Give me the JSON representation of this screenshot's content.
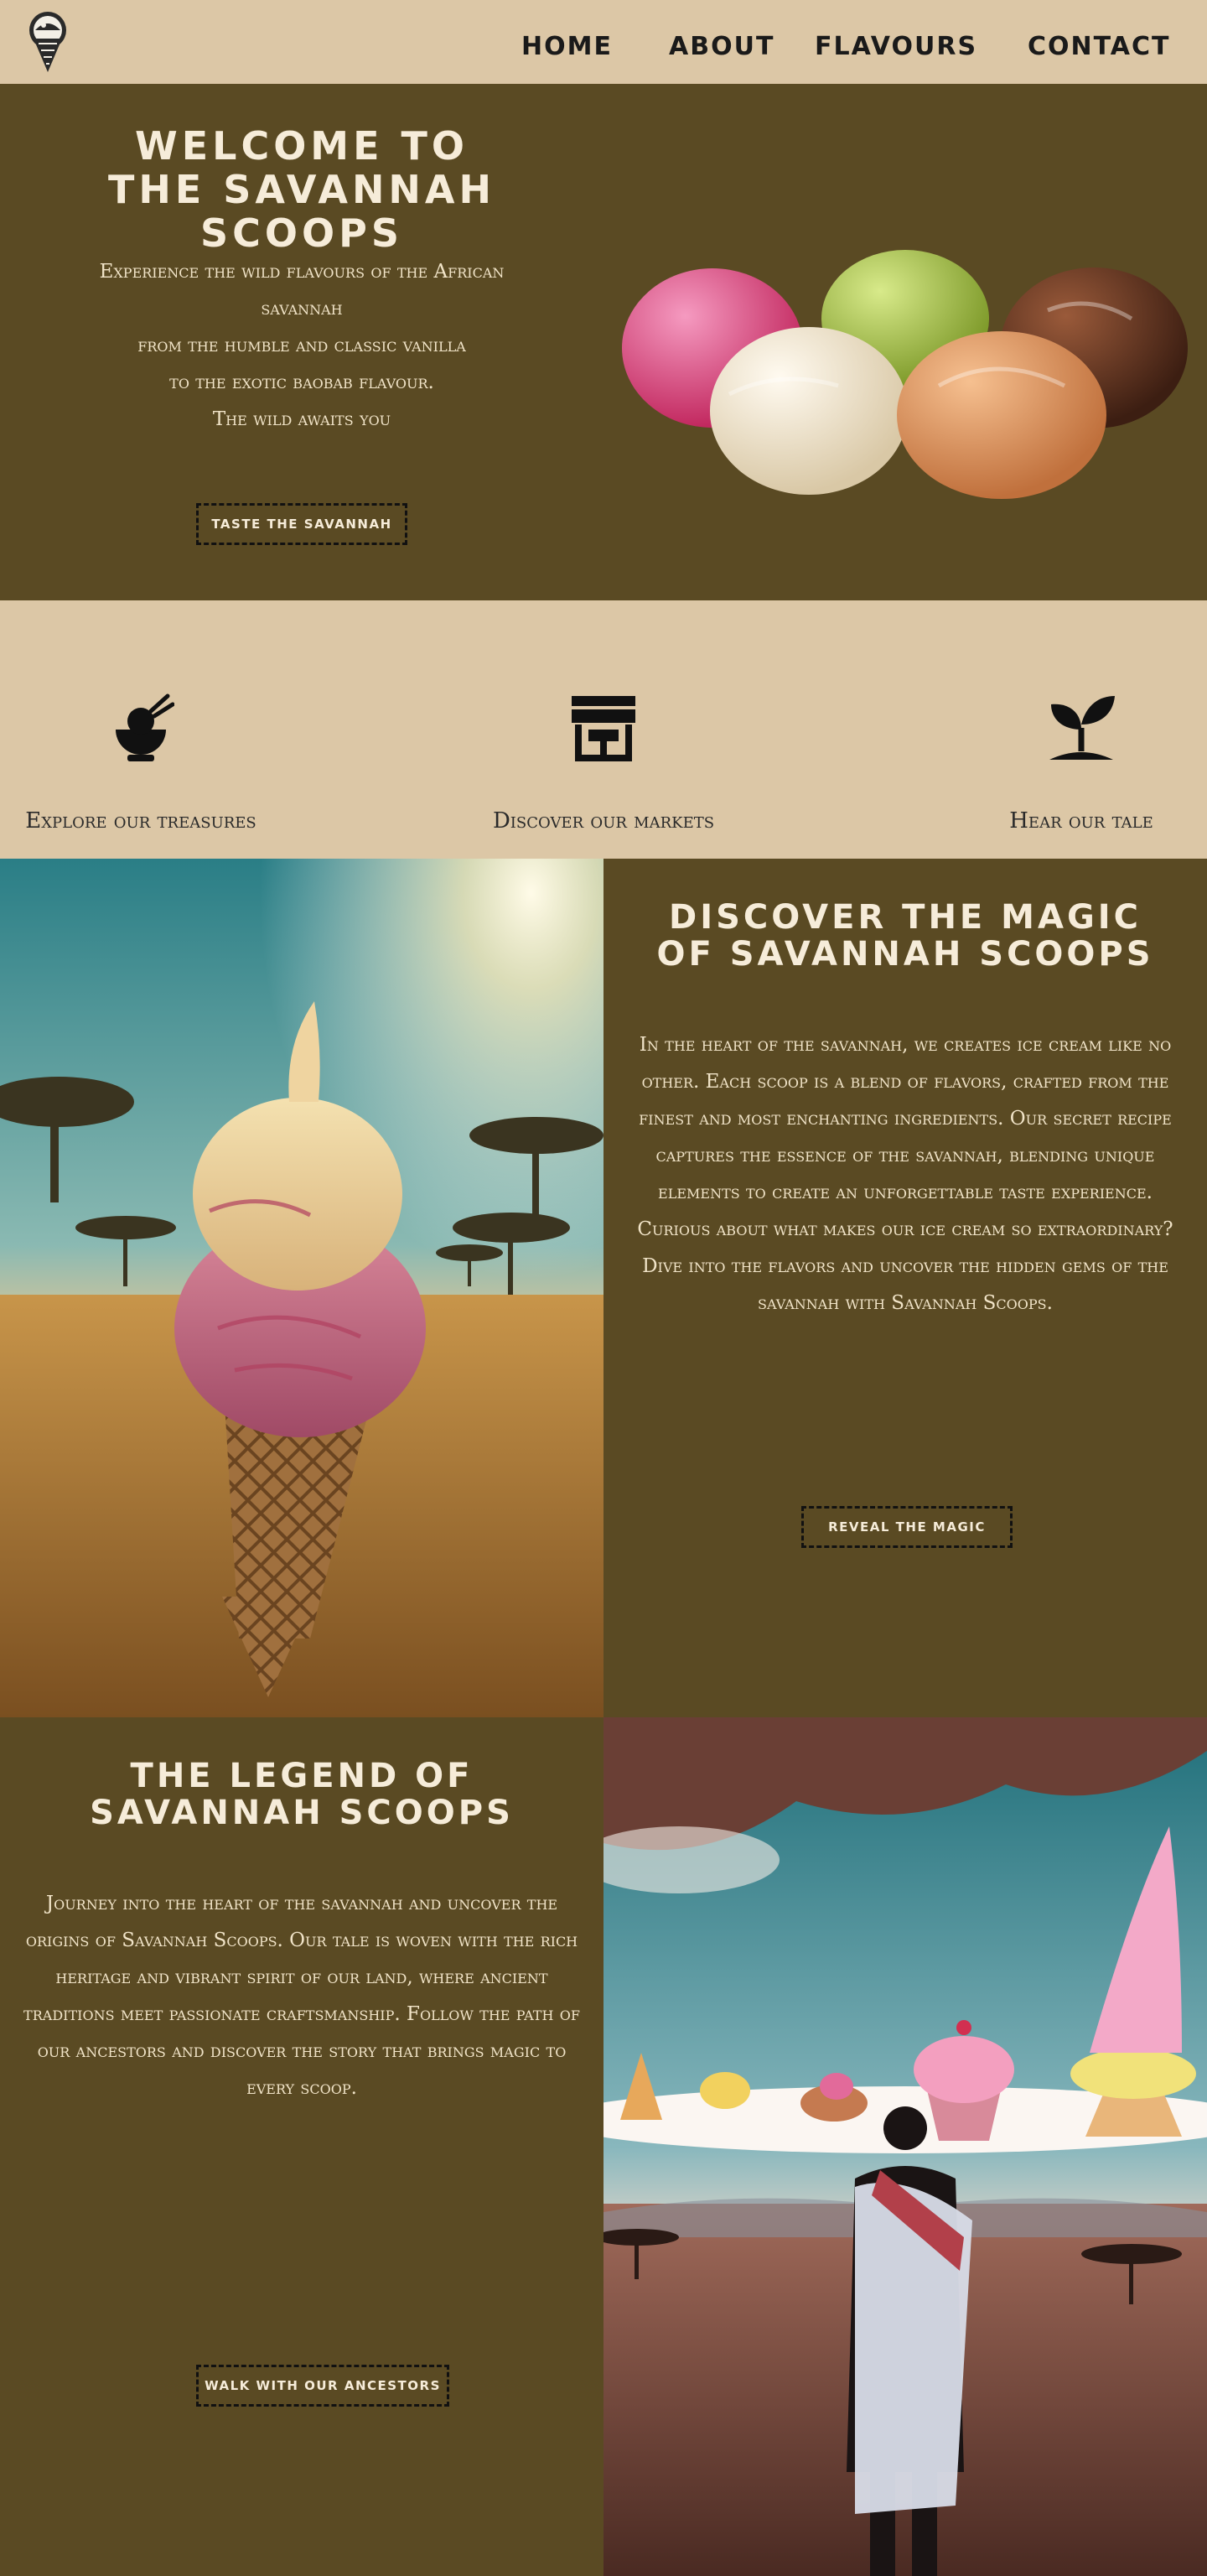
{
  "nav": {
    "logo_icon": "ice-cream-cone-logo-icon",
    "links": [
      "HOME",
      "ABOUT",
      "FLAVOURS",
      "CONTACT"
    ]
  },
  "hero": {
    "title_line1": "WELCOME TO",
    "title_line2": "THE SAVANNAH SCOOPS",
    "text": [
      "Experience the wild flavours of the African",
      "savannah",
      "from the humble and classic vanilla",
      "to the exotic baobab flavour.",
      "The wild awaits you"
    ],
    "button": "TASTE THE SAVANNAH"
  },
  "features": [
    {
      "icon": "bowl-icon",
      "label": "Explore our treasures"
    },
    {
      "icon": "store-icon",
      "label": "Discover our markets"
    },
    {
      "icon": "sprout-icon",
      "label": "Hear our tale"
    }
  ],
  "discover": {
    "title_line1": "DISCOVER THE MAGIC",
    "title_line2": "OF SAVANNAH SCOOPS",
    "para1": "In the heart of the savannah, we creates ice cream like no other. Each scoop is a blend of flavors, crafted from the finest and most enchanting ingredients. Our secret recipe captures the essence of the savannah, blending unique elements to create an unforgettable taste experience.",
    "para2": "Curious about what makes our ice cream so extraordinary? Dive into the flavors and uncover the hidden gems of the savannah with Savannah Scoops.",
    "button": "REVEAL THE MAGIC"
  },
  "legend": {
    "title_line1": "THE LEGEND OF",
    "title_line2": "SAVANNAH SCOOPS",
    "para": "Journey into the heart of the savannah and uncover the origins of Savannah Scoops. Our tale is woven with the rich heritage and vibrant spirit of our land, where ancient traditions meet passionate craftsmanship. Follow the path of our ancestors and discover the story that brings magic to every scoop.",
    "button": "WALK WITH OUR ANCESTORS"
  },
  "colors": {
    "brown": "#5a4a23",
    "sand": "#dcc7a6",
    "cream": "#f6ecd9"
  }
}
